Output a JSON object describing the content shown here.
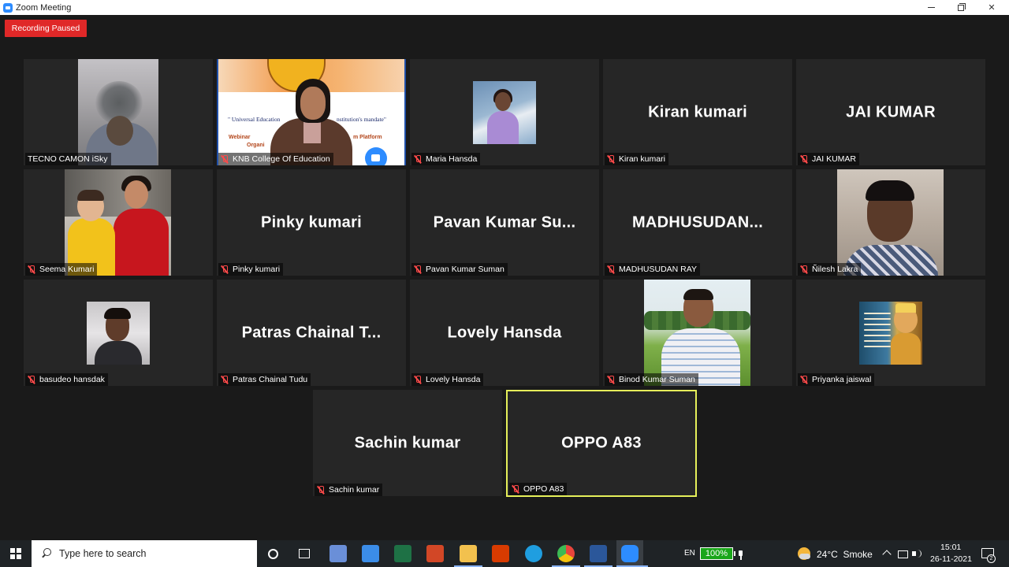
{
  "window": {
    "title": "Zoom Meeting",
    "icon": "zoom-icon",
    "controls": [
      "minimize",
      "maximize",
      "close"
    ]
  },
  "recording": {
    "label": "Recording Paused",
    "color": "#e02828"
  },
  "accent": {
    "active_speaker_border": "#e6f05a",
    "mic_muted": "#ff4a4a",
    "tile_bg": "#262626"
  },
  "participants": [
    {
      "name": "TECNO CAMON iSky",
      "display": "",
      "video": true,
      "muted": false
    },
    {
      "name": "KNB College Of Education",
      "display": "",
      "video": true,
      "muted": true,
      "banner": {
        "line1": "\" Universal Education",
        "line2": "nstitution's mandate\"",
        "web1": "Webinar",
        "web2": "Organi",
        "web3": "m Platform"
      }
    },
    {
      "name": "Maria Hansda",
      "display": "",
      "video": true,
      "muted": true
    },
    {
      "name": "Kiran kumari",
      "display": "Kiran kumari",
      "video": false,
      "muted": true
    },
    {
      "name": "JAI KUMAR",
      "display": "JAI KUMAR",
      "video": false,
      "muted": true
    },
    {
      "name": "Seema Kumari",
      "display": "",
      "video": true,
      "muted": true
    },
    {
      "name": "Pinky kumari",
      "display": "Pinky kumari",
      "video": false,
      "muted": true
    },
    {
      "name": "Pavan Kumar Suman",
      "display": "Pavan Kumar Su...",
      "video": false,
      "muted": true
    },
    {
      "name": "MADHUSUDAN RAY",
      "display": "MADHUSUDAN...",
      "video": false,
      "muted": true
    },
    {
      "name": "Ñilesh Lakra",
      "display": "",
      "video": true,
      "muted": true
    },
    {
      "name": "basudeo hansdak",
      "display": "",
      "video": true,
      "muted": true
    },
    {
      "name": "Patras Chainal Tudu",
      "display": "Patras Chainal T...",
      "video": false,
      "muted": true
    },
    {
      "name": "Lovely Hansda",
      "display": "Lovely Hansda",
      "video": false,
      "muted": true
    },
    {
      "name": "Binod Kumar Suman",
      "display": "",
      "video": true,
      "muted": true
    },
    {
      "name": "Priyanka jaiswal",
      "display": "",
      "video": true,
      "muted": true
    },
    {
      "name": "Sachin kumar",
      "display": "Sachin kumar",
      "video": false,
      "muted": true
    },
    {
      "name": "OPPO A83",
      "display": "OPPO A83",
      "video": false,
      "muted": true,
      "active_speaker": true
    }
  ],
  "taskbar": {
    "search_placeholder": "Type here to search",
    "apps": [
      {
        "name": "cortana-icon"
      },
      {
        "name": "task-view-icon"
      },
      {
        "name": "app-icon-1",
        "color": "#6a8fd8"
      },
      {
        "name": "store-icon",
        "color": "#3b8de8"
      },
      {
        "name": "excel-icon",
        "color": "#1e7145"
      },
      {
        "name": "app-icon-2",
        "color": "#d24726"
      },
      {
        "name": "file-explorer-icon",
        "color": "#f2c14e"
      },
      {
        "name": "office-icon",
        "color": "#d83b01"
      },
      {
        "name": "edge-icon",
        "color": "#1f9ee0"
      },
      {
        "name": "chrome-icon",
        "color": "#e8453c"
      },
      {
        "name": "word-icon",
        "color": "#2b579a"
      },
      {
        "name": "zoom-icon",
        "color": "#2d8cff"
      }
    ],
    "language": "EN",
    "battery": "100%",
    "weather": "24°C  Smoke",
    "time": "15:01",
    "date": "26-11-2021",
    "notifications": "2"
  }
}
